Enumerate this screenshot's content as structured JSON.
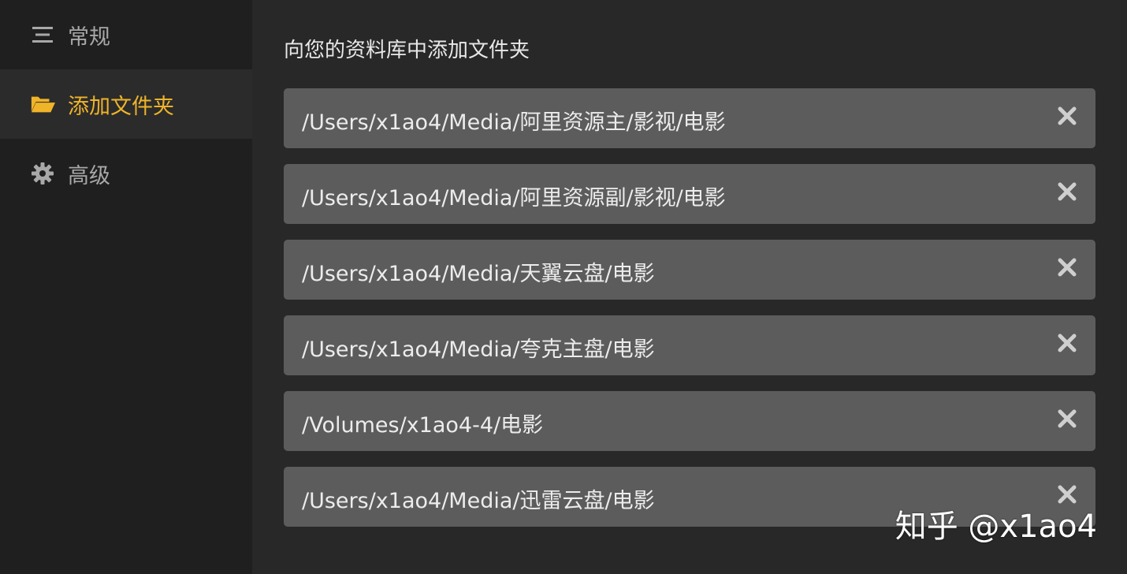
{
  "sidebar": {
    "items": [
      {
        "label": "常规",
        "icon": "list-icon",
        "active": false
      },
      {
        "label": "添加文件夹",
        "icon": "folder-open-icon",
        "active": true
      },
      {
        "label": "高级",
        "icon": "gear-icon",
        "active": false
      }
    ]
  },
  "main": {
    "title": "向您的资料库中添加文件夹",
    "folders": [
      {
        "path": "/Users/x1ao4/Media/阿里资源主/影视/电影"
      },
      {
        "path": "/Users/x1ao4/Media/阿里资源副/影视/电影"
      },
      {
        "path": "/Users/x1ao4/Media/天翼云盘/电影"
      },
      {
        "path": "/Users/x1ao4/Media/夸克主盘/电影"
      },
      {
        "path": "/Volumes/x1ao4-4/电影"
      },
      {
        "path": "/Users/x1ao4/Media/迅雷云盘/电影"
      }
    ],
    "remove_icon": "close-icon"
  },
  "watermark": "知乎 @x1ao4",
  "colors": {
    "sidebar_bg": "#1f1f1f",
    "main_bg": "#282828",
    "row_bg": "#5c5c5c",
    "accent": "#f0b429",
    "muted_text": "#a8a8a8",
    "icon_gray": "#cfcfcf"
  }
}
